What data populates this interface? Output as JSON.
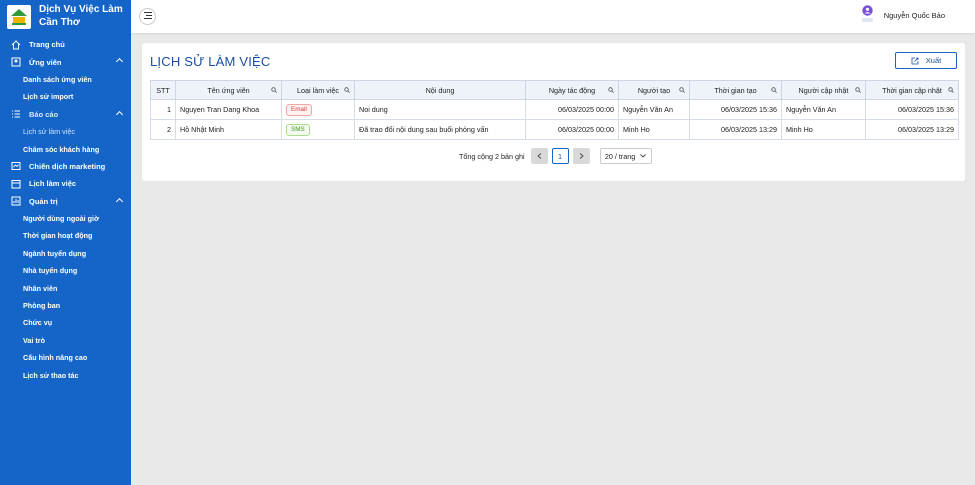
{
  "app": {
    "title": "Dịch Vụ Việc Làm Cần Thơ",
    "brand_color": "#1565c9"
  },
  "sidebar": {
    "items": [
      {
        "label": "Trang chủ",
        "icon": "home-icon"
      },
      {
        "label": "Ứng viên",
        "icon": "user-icon",
        "expanded": true,
        "children": [
          "Danh sách ứng viên",
          "Lịch sử import"
        ]
      },
      {
        "label": "Báo cáo",
        "icon": "list-icon",
        "expanded": true,
        "children": [
          "Lịch sử làm việc",
          "Chăm sóc khách hàng"
        ]
      },
      {
        "label": "Chiến dịch marketing",
        "icon": "campaign-icon"
      },
      {
        "label": "Lịch làm việc",
        "icon": "calendar-icon"
      },
      {
        "label": "Quản trị",
        "icon": "admin-icon",
        "expanded": true,
        "children": [
          "Người dùng ngoài giờ",
          "Thời gian hoạt động",
          "Ngành tuyển dụng",
          "Nhà tuyển dụng",
          "Nhân viên",
          "Phòng ban",
          "Chức vụ",
          "Vai trò",
          "Cấu hình nâng cao",
          "Lịch sử thao tác"
        ]
      }
    ],
    "active": "Lịch sử làm việc"
  },
  "header": {
    "user_name": "Nguyễn Quốc Bảo"
  },
  "main": {
    "page_title": "LỊCH SỬ LÀM VIỆC",
    "export_label": "Xuất",
    "columns": [
      "STT",
      "Tên ứng viên",
      "Loại làm việc",
      "Nội dung",
      "Ngày tác động",
      "Người tạo",
      "Thời gian tạo",
      "Người cập nhật",
      "Thời gian cập nhật"
    ],
    "rows": [
      {
        "stt": "1",
        "name": "Nguyen Tran Dang Khoa",
        "type": "Email",
        "content": "Noi dung",
        "action_date": "06/03/2025 00:00",
        "creator": "Nguyễn Văn An",
        "created_at": "06/03/2025 15:36",
        "updater": "Nguyễn Văn An",
        "updated_at": "06/03/2025 15:36"
      },
      {
        "stt": "2",
        "name": "Hồ Nhật Minh",
        "type": "SMS",
        "content": "Đã trao đổi nội dung sau buổi phỏng vấn",
        "action_date": "06/03/2025 00:00",
        "creator": "Minh Ho",
        "created_at": "06/03/2025 13:29",
        "updater": "Minh Ho",
        "updated_at": "06/03/2025 13:29"
      }
    ],
    "pagination": {
      "total_text": "Tổng cộng 2 bản ghi",
      "current_page": "1",
      "page_size": "20 / trang"
    }
  }
}
